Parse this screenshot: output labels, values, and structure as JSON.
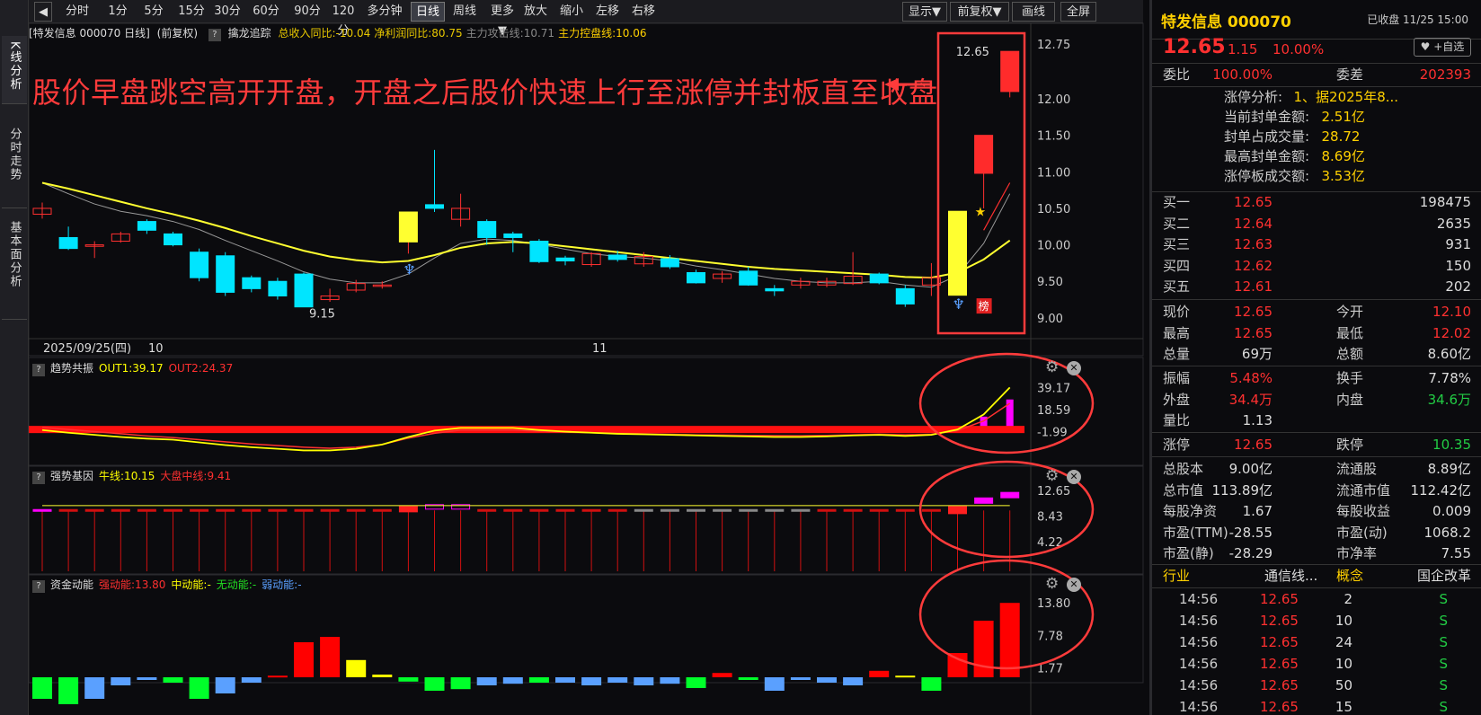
{
  "left_tabs": [
    {
      "label": "K线分析"
    },
    {
      "label": "分时走势"
    },
    {
      "label": "基本面分析"
    }
  ],
  "toolbar": {
    "collapse_icon": "collapse-icon",
    "buttons": [
      "分时",
      "1分",
      "5分",
      "15分",
      "30分",
      "60分",
      "90分",
      "120分",
      "多分钟",
      "日线",
      "周线",
      "更多▼",
      "放大",
      "缩小",
      "左移",
      "右移"
    ],
    "right_buttons": [
      "显示▼",
      "前复权▼",
      "画线",
      "全屏"
    ],
    "selected": "日线"
  },
  "info": {
    "title": "[特发信息 000070 日线]",
    "adj": "(前复权)",
    "name": "擒龙追踪",
    "items": [
      {
        "text": "总收入同比:-10.04",
        "color": "#e8c800"
      },
      {
        "text": "净利润同比:80.75",
        "color": "#e8c800"
      },
      {
        "text": "主力攻击线:10.71",
        "color": "#888888"
      },
      {
        "text": "主力控盘线:10.06",
        "color": "#ffd000"
      }
    ]
  },
  "annotation": "股价早盘跳空高开开盘，开盘之后股价快速上行至涨停并封板直至收盘",
  "main": {
    "y_ticks": [
      "12.75",
      "12.00",
      "11.50",
      "11.00",
      "10.50",
      "10.00",
      "9.50",
      "9.00"
    ],
    "x_labels": [
      "2025/09/25(四)",
      "10",
      "11"
    ],
    "low_label": "9.15",
    "high_label": "12.65",
    "board_label": "榜"
  },
  "indicators": [
    {
      "name": "趋势共振",
      "items": [
        {
          "text": "OUT1:39.17",
          "color": "#ffff00"
        },
        {
          "text": "OUT2:24.37",
          "color": "#ff3030"
        }
      ],
      "ticks": [
        "39.17",
        "18.59",
        "-1.99"
      ]
    },
    {
      "name": "强势基因",
      "items": [
        {
          "text": "牛线:10.15",
          "color": "#ffff00"
        },
        {
          "text": "大盘中线:9.41",
          "color": "#ff3030"
        }
      ],
      "ticks": [
        "12.65",
        "8.43",
        "4.22"
      ]
    },
    {
      "name": "资金动能",
      "items": [
        {
          "text": "强动能:13.80",
          "color": "#ff3030"
        },
        {
          "text": "中动能:-",
          "color": "#ffff00"
        },
        {
          "text": "无动能:-",
          "color": "#22dd22"
        },
        {
          "text": "弱动能:-",
          "color": "#5aa0ff"
        }
      ],
      "ticks": [
        "13.80",
        "7.78",
        "1.77"
      ]
    }
  ],
  "quote": {
    "name": "特发信息 000070",
    "status": "已收盘 11/25 15:00",
    "price": "12.65",
    "change": "1.15",
    "pct": "10.00%",
    "watch": "+自选",
    "weibi_label": "委比",
    "weibi": "100.00%",
    "weicha_label": "委差",
    "weicha": "202393",
    "limit_info": [
      {
        "k": "涨停分析:",
        "v": "1、据2025年8..."
      },
      {
        "k": "当前封单金额:",
        "v": "2.51亿"
      },
      {
        "k": "封单占成交量:",
        "v": "28.72"
      },
      {
        "k": "最高封单金额:",
        "v": "8.69亿"
      },
      {
        "k": "涨停板成交额:",
        "v": "3.53亿"
      }
    ],
    "bids": [
      {
        "label": "买一",
        "price": "12.65",
        "vol": "198475"
      },
      {
        "label": "买二",
        "price": "12.64",
        "vol": "2635"
      },
      {
        "label": "买三",
        "price": "12.63",
        "vol": "931"
      },
      {
        "label": "买四",
        "price": "12.62",
        "vol": "150"
      },
      {
        "label": "买五",
        "price": "12.61",
        "vol": "202"
      }
    ],
    "stats1": [
      {
        "l1": "现价",
        "v1": "12.65",
        "c1": "#ff3030",
        "l2": "今开",
        "v2": "12.10",
        "c2": "#ff3030"
      },
      {
        "l1": "最高",
        "v1": "12.65",
        "c1": "#ff3030",
        "l2": "最低",
        "v2": "12.02",
        "c2": "#ff3030"
      },
      {
        "l1": "总量",
        "v1": "69万",
        "c1": "#dddddd",
        "l2": "总额",
        "v2": "8.60亿",
        "c2": "#dddddd"
      }
    ],
    "stats2": [
      {
        "l1": "振幅",
        "v1": "5.48%",
        "c1": "#ff3030",
        "l2": "换手",
        "v2": "7.78%",
        "c2": "#dddddd"
      },
      {
        "l1": "外盘",
        "v1": "34.4万",
        "c1": "#ff3030",
        "l2": "内盘",
        "v2": "34.6万",
        "c2": "#22cc44"
      },
      {
        "l1": "量比",
        "v1": "1.13",
        "c1": "#dddddd",
        "l2": "",
        "v2": "",
        "c2": "#dddddd"
      }
    ],
    "limits": {
      "l1": "涨停",
      "v1": "12.65",
      "l2": "跌停",
      "v2": "10.35"
    },
    "stats3": [
      {
        "l1": "总股本",
        "v1": "9.00亿",
        "l2": "流通股",
        "v2": "8.89亿"
      },
      {
        "l1": "总市值",
        "v1": "113.89亿",
        "l2": "流通市值",
        "v2": "112.42亿"
      },
      {
        "l1": "每股净资",
        "v1": "1.67",
        "l2": "每股收益",
        "v2": "0.009"
      },
      {
        "l1": "市盈(TTM)",
        "v1": "-28.55",
        "l2": "市盈(动)",
        "v2": "1068.2"
      },
      {
        "l1": "市盈(静)",
        "v1": "-28.29",
        "l2": "市净率",
        "v2": "7.55"
      }
    ],
    "industry": {
      "l1": "行业",
      "v1": "通信线...",
      "l2": "概念",
      "v2": "国企改革"
    },
    "ticks": [
      {
        "t": "14:56",
        "p": "12.65",
        "v": "2",
        "s": "S"
      },
      {
        "t": "14:56",
        "p": "12.65",
        "v": "10",
        "s": "S"
      },
      {
        "t": "14:56",
        "p": "12.65",
        "v": "24",
        "s": "S"
      },
      {
        "t": "14:56",
        "p": "12.65",
        "v": "10",
        "s": "S"
      },
      {
        "t": "14:56",
        "p": "12.65",
        "v": "50",
        "s": "S"
      },
      {
        "t": "14:56",
        "p": "12.65",
        "v": "15",
        "s": "S"
      }
    ]
  },
  "chart_data": [
    {
      "type": "candlestick",
      "title": "特发信息 000070 日线",
      "candles": [
        [
          10.42,
          10.5,
          10.58,
          10.36
        ],
        [
          10.1,
          9.95,
          10.25,
          9.93
        ],
        [
          9.98,
          10.0,
          10.05,
          9.82
        ],
        [
          10.05,
          10.15,
          10.18,
          10.03
        ],
        [
          10.32,
          10.2,
          10.35,
          10.15
        ],
        [
          10.15,
          10.0,
          10.18,
          9.98
        ],
        [
          9.9,
          9.55,
          9.95,
          9.5
        ],
        [
          9.85,
          9.35,
          9.9,
          9.3
        ],
        [
          9.55,
          9.4,
          9.58,
          9.35
        ],
        [
          9.5,
          9.3,
          9.55,
          9.25
        ],
        [
          9.6,
          9.15,
          9.62,
          9.15
        ],
        [
          9.25,
          9.3,
          9.4,
          9.22
        ],
        [
          9.38,
          9.47,
          9.52,
          9.35
        ],
        [
          9.45,
          9.45,
          9.5,
          9.4
        ],
        [
          10.04,
          10.45,
          10.45,
          9.88
        ],
        [
          10.55,
          10.5,
          11.3,
          10.45
        ],
        [
          10.35,
          10.5,
          10.7,
          10.25
        ],
        [
          10.32,
          10.1,
          10.35,
          10.0
        ],
        [
          10.15,
          10.1,
          10.18,
          9.9
        ],
        [
          10.05,
          9.77,
          10.08,
          9.75
        ],
        [
          9.82,
          9.78,
          9.85,
          9.72
        ],
        [
          9.73,
          9.88,
          9.9,
          9.7
        ],
        [
          9.86,
          9.8,
          9.92,
          9.77
        ],
        [
          9.74,
          9.84,
          9.9,
          9.7
        ],
        [
          9.81,
          9.7,
          9.86,
          9.67
        ],
        [
          9.62,
          9.48,
          9.66,
          9.47
        ],
        [
          9.54,
          9.6,
          9.64,
          9.48
        ],
        [
          9.64,
          9.45,
          9.7,
          9.44
        ],
        [
          9.4,
          9.37,
          9.45,
          9.3
        ],
        [
          9.45,
          9.5,
          9.55,
          9.4
        ],
        [
          9.45,
          9.5,
          9.55,
          9.42
        ],
        [
          9.47,
          9.57,
          9.9,
          9.45
        ],
        [
          9.6,
          9.48,
          9.62,
          9.46
        ],
        [
          9.4,
          9.19,
          9.45,
          9.15
        ],
        [
          9.45,
          9.55,
          9.75,
          9.3
        ],
        [
          9.31,
          10.46,
          10.46,
          9.31
        ],
        [
          10.98,
          11.5,
          11.5,
          10.5
        ],
        [
          12.1,
          12.65,
          12.65,
          12.02
        ]
      ],
      "ma_gray": [
        10.85,
        10.7,
        10.56,
        10.46,
        10.4,
        10.32,
        10.21,
        10.06,
        9.92,
        9.78,
        9.63,
        9.53,
        9.48,
        9.48,
        9.6,
        9.82,
        10.02,
        10.08,
        10.06,
        10.01,
        9.94,
        9.88,
        9.84,
        9.82,
        9.78,
        9.71,
        9.66,
        9.6,
        9.54,
        9.5,
        9.48,
        9.48,
        9.5,
        9.45,
        9.42,
        9.58,
        10.02,
        10.7
      ],
      "ma_yellow": [
        10.85,
        10.77,
        10.68,
        10.59,
        10.5,
        10.42,
        10.33,
        10.23,
        10.12,
        10.02,
        9.92,
        9.84,
        9.79,
        9.76,
        9.78,
        9.86,
        9.96,
        10.02,
        10.04,
        10.02,
        9.98,
        9.94,
        9.9,
        9.86,
        9.82,
        9.78,
        9.74,
        9.7,
        9.67,
        9.65,
        9.63,
        9.61,
        9.59,
        9.56,
        9.55,
        9.62,
        9.8,
        10.06
      ],
      "ylim": [
        8.9,
        12.8
      ],
      "x_labels": [
        "2025/09/25(四)",
        "10",
        "11"
      ]
    },
    {
      "type": "line",
      "title": "趋势共振",
      "series": [
        {
          "name": "OUT1",
          "values": [
            -0.5,
            -3.0,
            -5.0,
            -7.0,
            -8.5,
            -9.5,
            -12.0,
            -14.5,
            -16.5,
            -18.0,
            -19.5,
            -19.5,
            -18.0,
            -14.0,
            -7.0,
            -1.0,
            1.5,
            1.5,
            1.5,
            -0.5,
            -2.0,
            -3.0,
            -4.0,
            -4.5,
            -5.0,
            -5.5,
            -6.0,
            -6.5,
            -7.0,
            -7.0,
            -6.5,
            -5.5,
            -5.0,
            -6.0,
            -5.0,
            0.0,
            14.0,
            39.17
          ]
        },
        {
          "name": "OUT2",
          "values": [
            2.0,
            0.0,
            -2.0,
            -4.0,
            -6.0,
            -7.5,
            -9.5,
            -11.5,
            -13.5,
            -15.0,
            -16.5,
            -17.5,
            -16.5,
            -14.0,
            -8.0,
            -3.5,
            -0.5,
            -0.5,
            -0.5,
            -1.5,
            -2.5,
            -3.0,
            -3.5,
            -4.0,
            -4.5,
            -5.0,
            -5.2,
            -5.5,
            -5.7,
            -5.8,
            -5.5,
            -5.0,
            -4.5,
            -5.0,
            -4.5,
            -1.0,
            8.0,
            24.37
          ]
        }
      ],
      "bars": [
        0,
        0,
        0,
        0,
        0,
        0,
        0,
        0,
        0,
        0,
        0,
        0,
        0,
        0,
        0,
        0,
        2.5,
        2.5,
        2.5,
        0,
        0,
        0,
        0,
        0,
        0,
        0,
        0,
        0,
        0,
        0,
        0,
        0,
        0,
        0,
        0,
        3.0,
        12.0,
        28.0
      ],
      "ylim": [
        -25,
        42
      ]
    },
    {
      "type": "bar",
      "title": "强势基因",
      "series": [
        {
          "name": "牛线",
          "value": 10.15
        },
        {
          "name": "大盘中线",
          "value": 9.41
        }
      ],
      "ylim": [
        0,
        13.5
      ]
    },
    {
      "type": "bar",
      "title": "资金动能",
      "values": [
        -4,
        -5,
        -4,
        -1.5,
        -0.5,
        -1,
        -4,
        -3,
        -1,
        0.3,
        6.5,
        7.5,
        3.2,
        0.5,
        -0.8,
        -2.5,
        -2.2,
        -1.5,
        -1.2,
        -1,
        -1,
        -1.5,
        -1,
        -1.5,
        -1.2,
        -2,
        0.8,
        -0.5,
        -2.5,
        -0.5,
        -1,
        -1.5,
        1.2,
        0.3,
        -2.5,
        4.5,
        10.5,
        13.8
      ],
      "colors": [
        "g",
        "g",
        "b",
        "b",
        "b",
        "g",
        "g",
        "b",
        "b",
        "r",
        "r",
        "r",
        "y",
        "y",
        "g",
        "g",
        "g",
        "b",
        "b",
        "g",
        "b",
        "b",
        "b",
        "b",
        "b",
        "g",
        "r",
        "g",
        "b",
        "b",
        "b",
        "b",
        "r",
        "y",
        "g",
        "r",
        "r",
        "r"
      ],
      "ylim": [
        -6,
        15
      ]
    }
  ],
  "colors": {
    "up": "#ff3030",
    "down": "#00e5ff",
    "yellow": "#ffff30",
    "gray": "#999999",
    "red": "#ff0000",
    "magenta": "#ff00ff",
    "green": "#00ff2a",
    "blue": "#5aa0ff",
    "panelBg": "#0b0b0e"
  }
}
